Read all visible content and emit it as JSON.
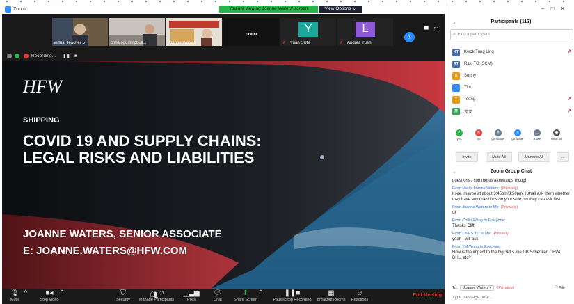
{
  "window": {
    "app_title": "Zoom"
  },
  "banner": {
    "message": "You are viewing Joanne Waters' screen",
    "options_label": "View Options ⌄"
  },
  "thumbnails": [
    {
      "name": "Virtual Teacher 5"
    },
    {
      "name": "chhalogustingbull..."
    },
    {
      "name": "Joanne Waters"
    },
    {
      "name": "",
      "tile_text": "coco"
    },
    {
      "name": "Yuan SUN",
      "letter": "Y",
      "color": "#1aa89c"
    },
    {
      "name": "Andrea Yuen",
      "letter": "L",
      "color": "#8e5ad9"
    }
  ],
  "recording": {
    "label": "Recording..."
  },
  "slide": {
    "logo": "HFW",
    "category": "SHIPPING",
    "title_line1": "COVID 19 AND SUPPLY CHAINS:",
    "title_line2": "LEGAL RISKS AND LIABILITIES",
    "presenter": "JOANNE WATERS, SENIOR ASSOCIATE",
    "email": "E: JOANNE.WATERS@HFW.COM"
  },
  "toolbar": {
    "mute": "Mute",
    "stop_video": "Stop Video",
    "security": "Security",
    "manage_participants": "Manage Participants",
    "participant_count": "113",
    "polls": "Polls",
    "chat": "Chat",
    "share_screen": "Share Screen",
    "pause_recording": "Pause/Stop Recording",
    "breakout_rooms": "Breakout Rooms",
    "reactions": "Reactions",
    "end_meeting": "End Meeting"
  },
  "participants": {
    "title": "Participants (113)",
    "search_placeholder": "Find a participant",
    "list": [
      {
        "initials": "KT",
        "name": "Kwok Tung Ling",
        "color": "#4a6fa5"
      },
      {
        "initials": "RT",
        "name": "Raki TO (SCM)",
        "color": "#4a6fa5"
      },
      {
        "initials": "S",
        "name": "Sunny",
        "color": "#e89a17"
      },
      {
        "initials": "T",
        "name": "Tim",
        "color": "#2d8cff"
      },
      {
        "initials": "T",
        "name": "Tseng",
        "color": "#e89a17"
      },
      {
        "initials": "茨",
        "name": "茨茨",
        "color": "#3aa35a"
      }
    ],
    "reactions": [
      {
        "label": "yes",
        "glyph": "✓",
        "color": "#2bb34b"
      },
      {
        "label": "no",
        "glyph": "✕",
        "color": "#e04848"
      },
      {
        "label": "go slower",
        "glyph": "«",
        "color": "#6f7c8c"
      },
      {
        "label": "go faster",
        "glyph": "»",
        "color": "#2d8cff"
      },
      {
        "label": "more",
        "glyph": "…",
        "color": "#6f7c8c"
      },
      {
        "label": "clear all",
        "glyph": "◆",
        "color": "#555555"
      }
    ],
    "invite": "Invite",
    "mute_all": "Mute All",
    "unmute_all": "Unmute All",
    "more": "..."
  },
  "chat": {
    "title": "Zoom Group Chat",
    "messages": [
      {
        "meta": "",
        "private": "",
        "text": "questions / comments afterwards though"
      },
      {
        "meta": "From Me to Joanne Waters:",
        "private": "(Privately)",
        "text": "I see, maybe at about 3:45pm/3:50pm, I shall ask them whether they have any questions on your side, so they can ask first."
      },
      {
        "meta": "From Joanne Waters to Me:",
        "private": "(Privately)",
        "text": "ok"
      },
      {
        "meta": "From Collin Wang to Everyone:",
        "private": "",
        "text": "Thanks Cliff"
      },
      {
        "meta": "From LINES YU to Me:",
        "private": "(Privately)",
        "text": "yeah I will ask"
      },
      {
        "meta": "From YM Wong to Everyone:",
        "private": "",
        "text": "How is the impact to the big 3PLs like DB Schenker, CEVA, DHL, etc?"
      }
    ],
    "to_label": "To:",
    "to_value": "Joanne Waters ▾",
    "to_private": "(Privately)",
    "file_label": "File",
    "input_placeholder": "Type message here..."
  }
}
